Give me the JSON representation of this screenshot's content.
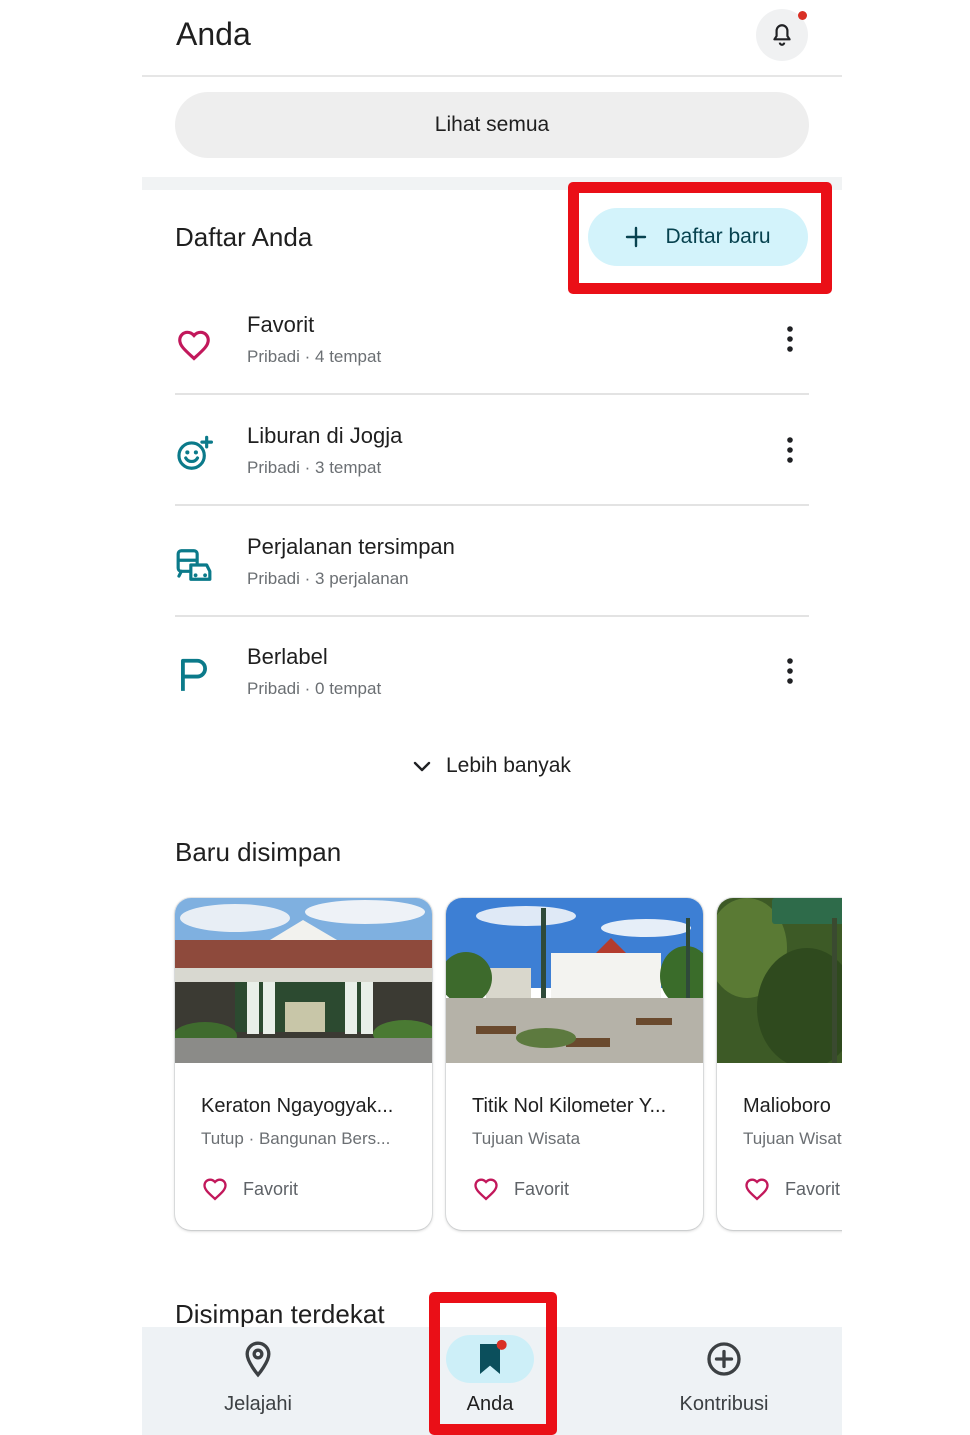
{
  "header": {
    "title": "Anda",
    "see_all_label": "Lihat semua"
  },
  "lists": {
    "title": "Daftar Anda",
    "new_list_label": "Daftar baru",
    "items": [
      {
        "name": "Favorit",
        "meta": "Pribadi · 4 tempat",
        "icon": "heart-icon"
      },
      {
        "name": "Liburan di Jogja",
        "meta": "Pribadi · 3 tempat",
        "icon": "emoji-add-icon"
      },
      {
        "name": "Perjalanan tersimpan",
        "meta": "Pribadi · 3 perjalanan",
        "icon": "commute-icon"
      },
      {
        "name": "Berlabel",
        "meta": "Pribadi · 0 tempat",
        "icon": "flag-icon"
      }
    ],
    "more_label": "Lebih banyak"
  },
  "recent": {
    "title": "Baru disimpan",
    "cards": [
      {
        "name": "Keraton Ngayogyak...",
        "subtitle": "Tutup · Bangunan Bers...",
        "list": "Favorit"
      },
      {
        "name": "Titik Nol Kilometer Y...",
        "subtitle": "Tujuan Wisata",
        "list": "Favorit"
      },
      {
        "name": "Malioboro",
        "subtitle": "Tujuan Wisata",
        "list": "Favorit"
      }
    ]
  },
  "nearby": {
    "title": "Disimpan terdekat"
  },
  "bottom_nav": [
    {
      "label": "Jelajahi",
      "icon": "location-pin-icon"
    },
    {
      "label": "Anda",
      "icon": "bookmark-icon",
      "active": true
    },
    {
      "label": "Kontribusi",
      "icon": "add-circle-icon"
    }
  ],
  "colors": {
    "accent": "#0b7a8a",
    "favorite": "#c2185b",
    "highlight_box": "#ea0f17",
    "notification_dot": "#d93025"
  }
}
